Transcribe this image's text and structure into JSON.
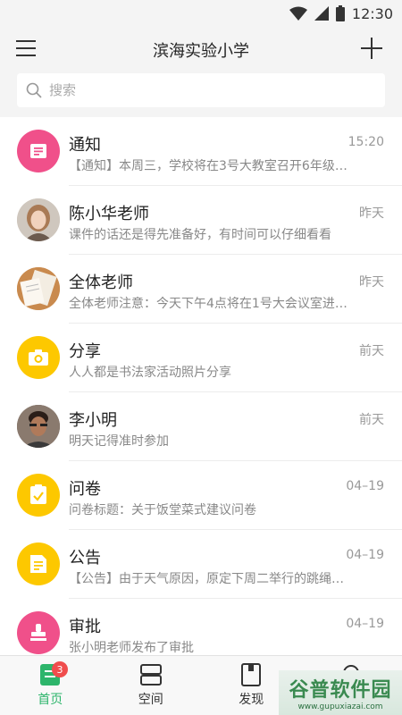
{
  "status_bar": {
    "time": "12:30",
    "icons": [
      "wifi-icon",
      "signal-icon",
      "battery-icon"
    ]
  },
  "header": {
    "title": "滨海实验小学",
    "left_icon": "menu-icon",
    "right_icon": "plus-icon"
  },
  "search": {
    "placeholder": "搜索"
  },
  "conversations": [
    {
      "name": "通知",
      "time": "15:20",
      "preview": "【通知】本周三，学校将在3号大教室召开6年级…",
      "icon": "notice-icon",
      "color": "#f0508a"
    },
    {
      "name": "陈小华老师",
      "time": "昨天",
      "preview": "课件的话还是得先准备好，有时间可以仔细看看",
      "icon": "avatar-photo-woman",
      "color": "#b8a089"
    },
    {
      "name": "全体老师",
      "time": "昨天",
      "preview": "全体老师注意：今天下午4点将在1号大会议室进…",
      "icon": "avatar-photo-papers",
      "color": "#d9a96a"
    },
    {
      "name": "分享",
      "time": "前天",
      "preview": "人人都是书法家活动照片分享",
      "icon": "camera-icon",
      "color": "#fdc800"
    },
    {
      "name": "李小明",
      "time": "前天",
      "preview": "明天记得准时参加",
      "icon": "avatar-photo-man",
      "color": "#5a4a40"
    },
    {
      "name": "问卷",
      "time": "04–19",
      "preview": "问卷标题：关于饭堂菜式建议问卷",
      "icon": "survey-icon",
      "color": "#fdc800"
    },
    {
      "name": "公告",
      "time": "04–19",
      "preview": "【公告】由于天气原因，原定下周二举行的跳绳…",
      "icon": "announcement-icon",
      "color": "#fdc800"
    },
    {
      "name": "审批",
      "time": "04–19",
      "preview": "张小明老师发布了审批",
      "icon": "approval-stamp-icon",
      "color": "#f0508a"
    }
  ],
  "tabs": [
    {
      "label": "首页",
      "icon": "home-icon",
      "badge": "3",
      "active": true
    },
    {
      "label": "空间",
      "icon": "space-icon"
    },
    {
      "label": "发现",
      "icon": "discover-icon"
    },
    {
      "label": "",
      "icon": "search-icon"
    }
  ],
  "watermark": {
    "main": "谷普软件园",
    "sub": "www.gupuxiazai.com"
  }
}
